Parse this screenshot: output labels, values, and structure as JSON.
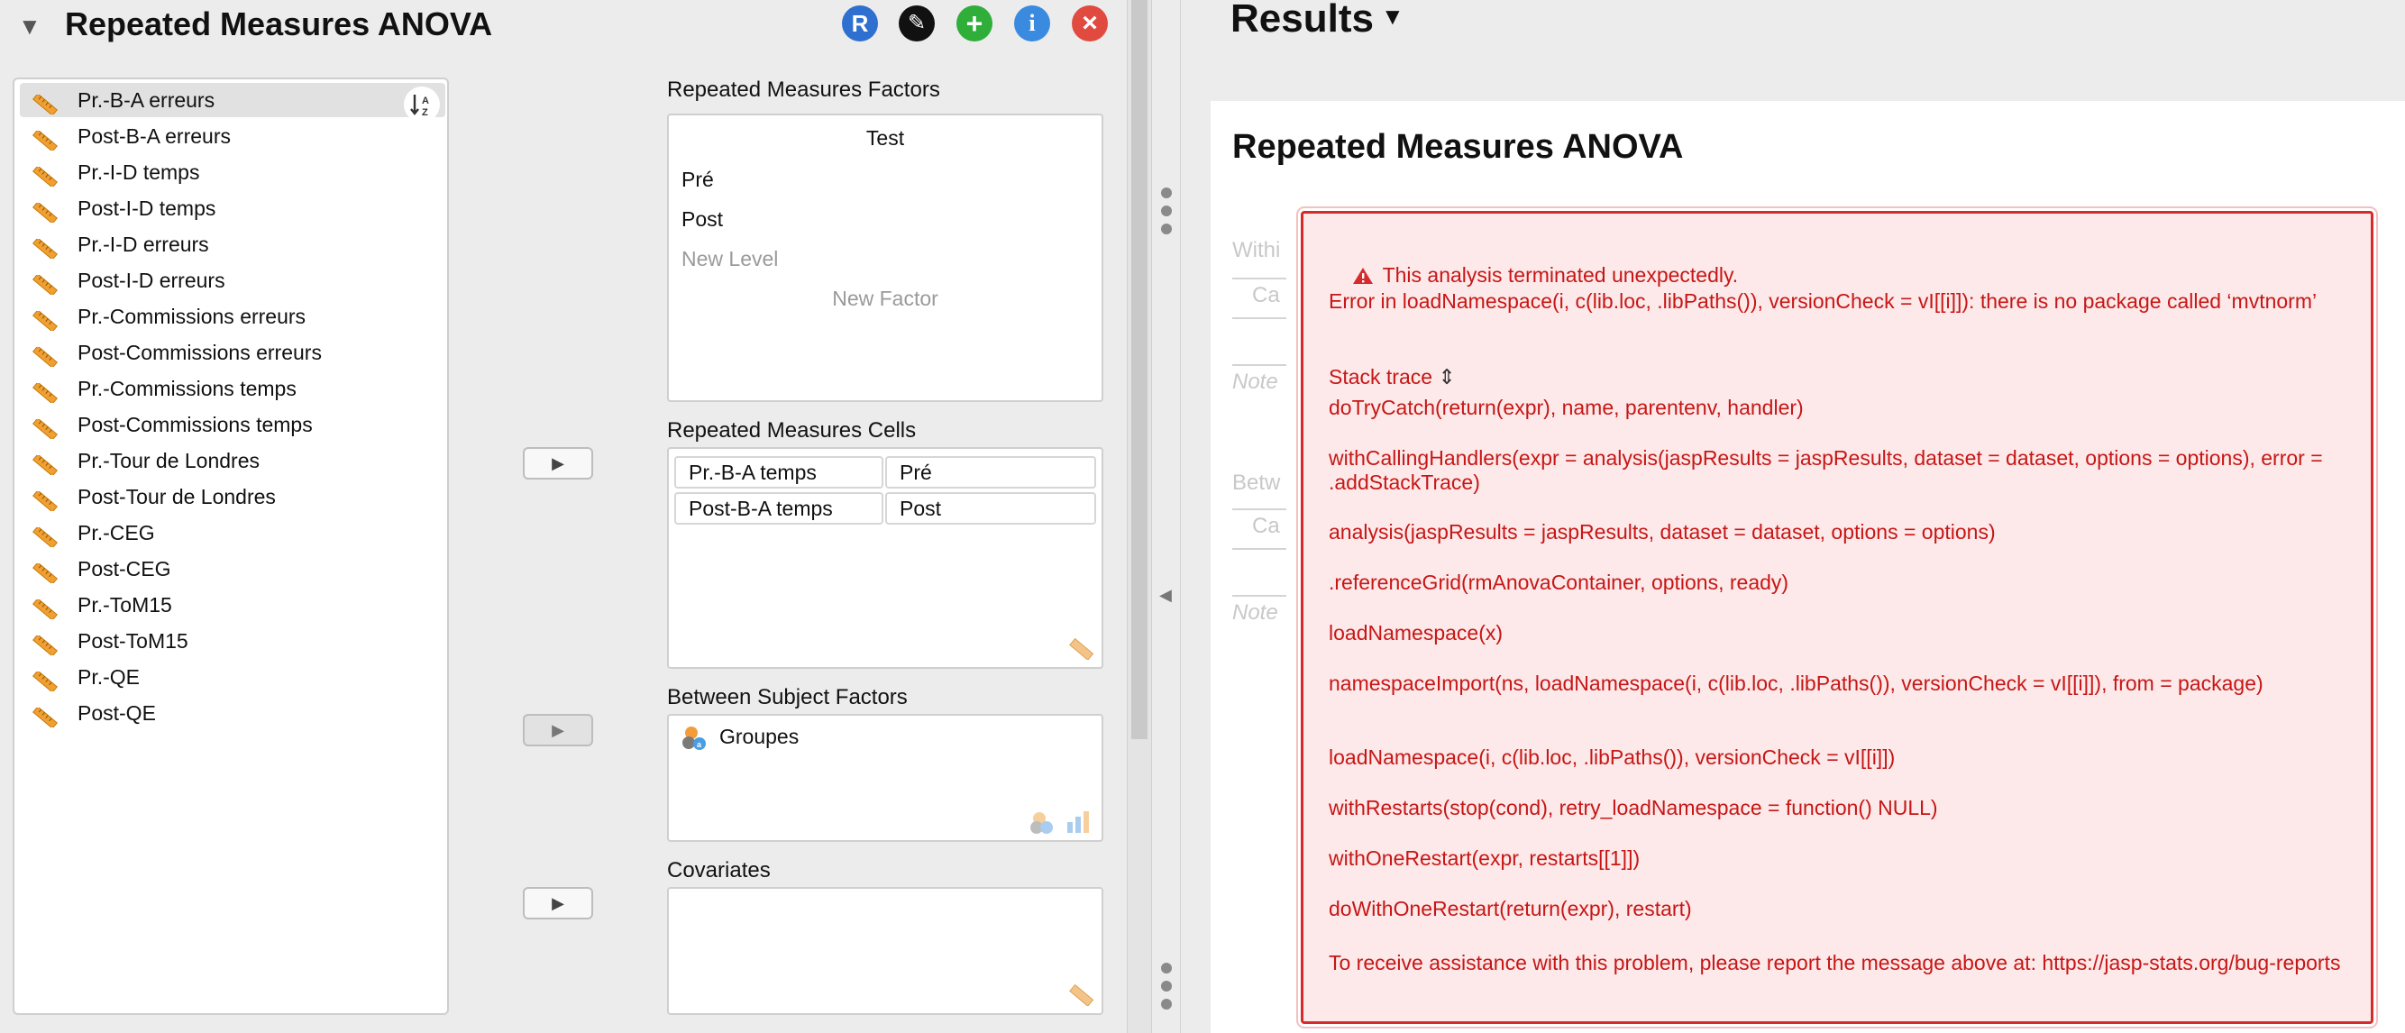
{
  "analysis": {
    "title": "Repeated Measures ANOVA",
    "buttons": [
      "R",
      "✎",
      "+",
      "i",
      "×"
    ],
    "sort_icon_text": "↓A Z"
  },
  "variables": [
    "Pr.-B-A erreurs",
    "Post-B-A erreurs",
    "Pr.-I-D temps",
    "Post-I-D temps",
    "Pr.-I-D erreurs",
    "Post-I-D erreurs",
    "Pr.-Commissions erreurs",
    "Post-Commissions erreurs",
    "Pr.-Commissions temps",
    "Post-Commissions temps",
    "Pr.-Tour de Londres",
    "Post-Tour de Londres",
    "Pr.-CEG",
    "Post-CEG",
    "Pr.-ToM15",
    "Post-ToM15",
    "Pr.-QE",
    "Post-QE"
  ],
  "rm_factors": {
    "title": "Repeated Measures Factors",
    "factor_name": "Test",
    "levels": [
      "Pré",
      "Post"
    ],
    "new_level_placeholder": "New Level",
    "new_factor_placeholder": "New Factor"
  },
  "rm_cells": {
    "title": "Repeated Measures Cells",
    "rows": [
      {
        "variable": "Pr.-B-A temps",
        "level": "Pré"
      },
      {
        "variable": "Post-B-A temps",
        "level": "Post"
      }
    ]
  },
  "between": {
    "title": "Between Subject Factors",
    "items": [
      "Groupes"
    ]
  },
  "covariates": {
    "title": "Covariates"
  },
  "results": {
    "header": "Results",
    "caret": "▼",
    "analysis_title": "Repeated Measures ANOVA",
    "ghost": {
      "within": "Withi",
      "between": "Betw",
      "c1": "Ca",
      "c2": "Ca",
      "note1": "Note",
      "note2": "Note"
    }
  },
  "error": {
    "heading": "This analysis terminated unexpectedly.",
    "message": "Error in loadNamespace(i, c(lib.loc, .libPaths()), versionCheck = vI[[i]]): there is no package called ‘mvtnorm’",
    "stack_label": "Stack trace",
    "stack_toggle": "⇕",
    "trace": [
      "doTryCatch(return(expr), name, parentenv, handler)",
      "withCallingHandlers(expr = analysis(jaspResults = jaspResults, dataset = dataset, options = options), error = .addStackTrace)",
      "analysis(jaspResults = jaspResults, dataset = dataset, options = options)",
      ".referenceGrid(rmAnovaContainer, options, ready)",
      "loadNamespace(x)",
      "namespaceImport(ns, loadNamespace(i, c(lib.loc, .libPaths()), versionCheck = vI[[i]]), from = package)",
      "loadNamespace(i, c(lib.loc, .libPaths()), versionCheck = vI[[i]])",
      "withRestarts(stop(cond), retry_loadNamespace = function() NULL)",
      "withOneRestart(expr, restarts[[1]])",
      "doWithOneRestart(return(expr), restart)"
    ],
    "assistance": "To receive assistance with this problem, please report the message above at: https://jasp-stats.org/bug-reports"
  },
  "colors": {
    "r_button": "#2f6fcf",
    "edit_button": "#111111",
    "add_button": "#2fae3a",
    "info_button": "#3a8be0",
    "close_button": "#e04a3f",
    "error_text": "#c71616",
    "error_bg": "#fde9e9",
    "ruler": "#f0a030"
  },
  "icons": {
    "collapse": "collapse-triangle-icon",
    "variable": "ruler-icon",
    "nominal": "nominal-icon",
    "warning": "warning-triangle-icon"
  }
}
